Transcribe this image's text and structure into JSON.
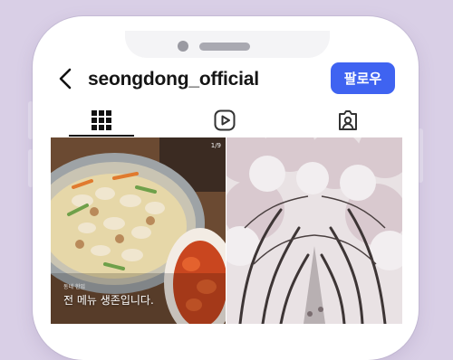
{
  "profile": {
    "username": "seongdong_official",
    "follow_label": "팔로우"
  },
  "tabs": {
    "items": [
      {
        "icon": "grid-icon",
        "active": true
      },
      {
        "icon": "reels-play-icon",
        "active": false
      },
      {
        "icon": "tagged-person-icon",
        "active": false
      }
    ]
  },
  "posts": [
    {
      "counter": "1/9",
      "caption_small": "동네 한입",
      "caption": "전 메뉴 생존입니다."
    },
    {
      "scene": "cherry blossom tree-lined road"
    }
  ],
  "colors": {
    "background": "#d9cfe6",
    "follow_button": "#3f63f1",
    "text": "#151515"
  }
}
